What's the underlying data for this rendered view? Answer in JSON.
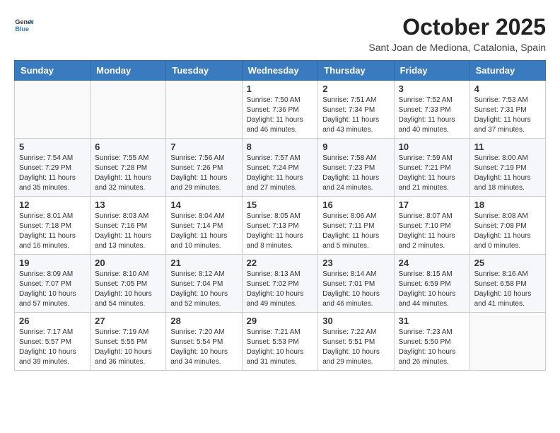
{
  "header": {
    "logo_general": "General",
    "logo_blue": "Blue",
    "month_year": "October 2025",
    "location": "Sant Joan de Mediona, Catalonia, Spain"
  },
  "weekdays": [
    "Sunday",
    "Monday",
    "Tuesday",
    "Wednesday",
    "Thursday",
    "Friday",
    "Saturday"
  ],
  "weeks": [
    [
      {
        "day": "",
        "sunrise": "",
        "sunset": "",
        "daylight": ""
      },
      {
        "day": "",
        "sunrise": "",
        "sunset": "",
        "daylight": ""
      },
      {
        "day": "",
        "sunrise": "",
        "sunset": "",
        "daylight": ""
      },
      {
        "day": "1",
        "sunrise": "Sunrise: 7:50 AM",
        "sunset": "Sunset: 7:36 PM",
        "daylight": "Daylight: 11 hours and 46 minutes."
      },
      {
        "day": "2",
        "sunrise": "Sunrise: 7:51 AM",
        "sunset": "Sunset: 7:34 PM",
        "daylight": "Daylight: 11 hours and 43 minutes."
      },
      {
        "day": "3",
        "sunrise": "Sunrise: 7:52 AM",
        "sunset": "Sunset: 7:33 PM",
        "daylight": "Daylight: 11 hours and 40 minutes."
      },
      {
        "day": "4",
        "sunrise": "Sunrise: 7:53 AM",
        "sunset": "Sunset: 7:31 PM",
        "daylight": "Daylight: 11 hours and 37 minutes."
      }
    ],
    [
      {
        "day": "5",
        "sunrise": "Sunrise: 7:54 AM",
        "sunset": "Sunset: 7:29 PM",
        "daylight": "Daylight: 11 hours and 35 minutes."
      },
      {
        "day": "6",
        "sunrise": "Sunrise: 7:55 AM",
        "sunset": "Sunset: 7:28 PM",
        "daylight": "Daylight: 11 hours and 32 minutes."
      },
      {
        "day": "7",
        "sunrise": "Sunrise: 7:56 AM",
        "sunset": "Sunset: 7:26 PM",
        "daylight": "Daylight: 11 hours and 29 minutes."
      },
      {
        "day": "8",
        "sunrise": "Sunrise: 7:57 AM",
        "sunset": "Sunset: 7:24 PM",
        "daylight": "Daylight: 11 hours and 27 minutes."
      },
      {
        "day": "9",
        "sunrise": "Sunrise: 7:58 AM",
        "sunset": "Sunset: 7:23 PM",
        "daylight": "Daylight: 11 hours and 24 minutes."
      },
      {
        "day": "10",
        "sunrise": "Sunrise: 7:59 AM",
        "sunset": "Sunset: 7:21 PM",
        "daylight": "Daylight: 11 hours and 21 minutes."
      },
      {
        "day": "11",
        "sunrise": "Sunrise: 8:00 AM",
        "sunset": "Sunset: 7:19 PM",
        "daylight": "Daylight: 11 hours and 18 minutes."
      }
    ],
    [
      {
        "day": "12",
        "sunrise": "Sunrise: 8:01 AM",
        "sunset": "Sunset: 7:18 PM",
        "daylight": "Daylight: 11 hours and 16 minutes."
      },
      {
        "day": "13",
        "sunrise": "Sunrise: 8:03 AM",
        "sunset": "Sunset: 7:16 PM",
        "daylight": "Daylight: 11 hours and 13 minutes."
      },
      {
        "day": "14",
        "sunrise": "Sunrise: 8:04 AM",
        "sunset": "Sunset: 7:14 PM",
        "daylight": "Daylight: 11 hours and 10 minutes."
      },
      {
        "day": "15",
        "sunrise": "Sunrise: 8:05 AM",
        "sunset": "Sunset: 7:13 PM",
        "daylight": "Daylight: 11 hours and 8 minutes."
      },
      {
        "day": "16",
        "sunrise": "Sunrise: 8:06 AM",
        "sunset": "Sunset: 7:11 PM",
        "daylight": "Daylight: 11 hours and 5 minutes."
      },
      {
        "day": "17",
        "sunrise": "Sunrise: 8:07 AM",
        "sunset": "Sunset: 7:10 PM",
        "daylight": "Daylight: 11 hours and 2 minutes."
      },
      {
        "day": "18",
        "sunrise": "Sunrise: 8:08 AM",
        "sunset": "Sunset: 7:08 PM",
        "daylight": "Daylight: 11 hours and 0 minutes."
      }
    ],
    [
      {
        "day": "19",
        "sunrise": "Sunrise: 8:09 AM",
        "sunset": "Sunset: 7:07 PM",
        "daylight": "Daylight: 10 hours and 57 minutes."
      },
      {
        "day": "20",
        "sunrise": "Sunrise: 8:10 AM",
        "sunset": "Sunset: 7:05 PM",
        "daylight": "Daylight: 10 hours and 54 minutes."
      },
      {
        "day": "21",
        "sunrise": "Sunrise: 8:12 AM",
        "sunset": "Sunset: 7:04 PM",
        "daylight": "Daylight: 10 hours and 52 minutes."
      },
      {
        "day": "22",
        "sunrise": "Sunrise: 8:13 AM",
        "sunset": "Sunset: 7:02 PM",
        "daylight": "Daylight: 10 hours and 49 minutes."
      },
      {
        "day": "23",
        "sunrise": "Sunrise: 8:14 AM",
        "sunset": "Sunset: 7:01 PM",
        "daylight": "Daylight: 10 hours and 46 minutes."
      },
      {
        "day": "24",
        "sunrise": "Sunrise: 8:15 AM",
        "sunset": "Sunset: 6:59 PM",
        "daylight": "Daylight: 10 hours and 44 minutes."
      },
      {
        "day": "25",
        "sunrise": "Sunrise: 8:16 AM",
        "sunset": "Sunset: 6:58 PM",
        "daylight": "Daylight: 10 hours and 41 minutes."
      }
    ],
    [
      {
        "day": "26",
        "sunrise": "Sunrise: 7:17 AM",
        "sunset": "Sunset: 5:57 PM",
        "daylight": "Daylight: 10 hours and 39 minutes."
      },
      {
        "day": "27",
        "sunrise": "Sunrise: 7:19 AM",
        "sunset": "Sunset: 5:55 PM",
        "daylight": "Daylight: 10 hours and 36 minutes."
      },
      {
        "day": "28",
        "sunrise": "Sunrise: 7:20 AM",
        "sunset": "Sunset: 5:54 PM",
        "daylight": "Daylight: 10 hours and 34 minutes."
      },
      {
        "day": "29",
        "sunrise": "Sunrise: 7:21 AM",
        "sunset": "Sunset: 5:53 PM",
        "daylight": "Daylight: 10 hours and 31 minutes."
      },
      {
        "day": "30",
        "sunrise": "Sunrise: 7:22 AM",
        "sunset": "Sunset: 5:51 PM",
        "daylight": "Daylight: 10 hours and 29 minutes."
      },
      {
        "day": "31",
        "sunrise": "Sunrise: 7:23 AM",
        "sunset": "Sunset: 5:50 PM",
        "daylight": "Daylight: 10 hours and 26 minutes."
      },
      {
        "day": "",
        "sunrise": "",
        "sunset": "",
        "daylight": ""
      }
    ]
  ]
}
